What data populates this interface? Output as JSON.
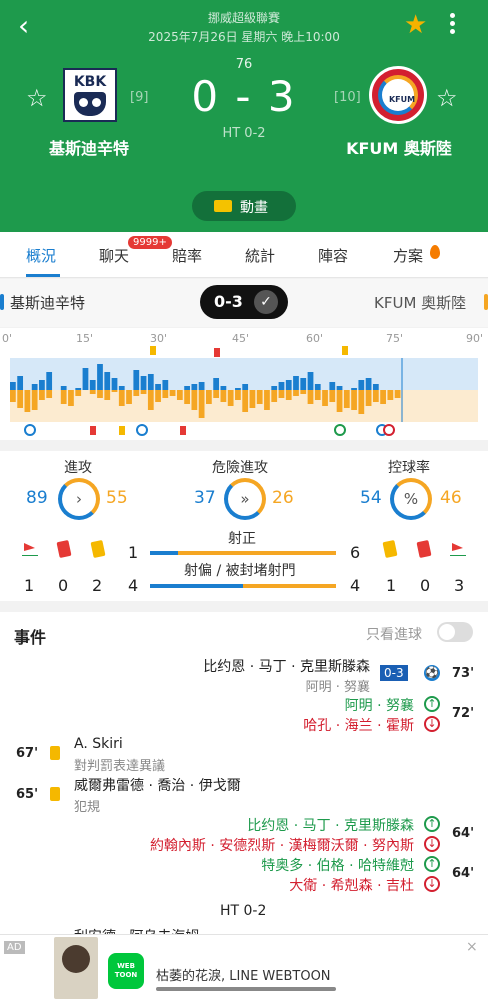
{
  "header": {
    "league": "挪威超級聯賽",
    "datetime": "2025年7月26日 星期六 晚上10:00",
    "minute": "76",
    "score": "0 - 3",
    "halftime": "HT 0-2",
    "home": {
      "name": "基斯迪辛特",
      "rank": "[9]",
      "logo_text": "KBK"
    },
    "away": {
      "name": "KFUM 奧斯陸",
      "rank": "[10]",
      "logo_text": "KFUM"
    },
    "animation_label": "動畫",
    "back_icon": "back-arrow-icon",
    "favorite_icon": "star-icon"
  },
  "tabs": [
    {
      "label": "概況",
      "active": true
    },
    {
      "label": "聊天",
      "badge": "9999+"
    },
    {
      "label": "賠率"
    },
    {
      "label": "統計"
    },
    {
      "label": "陣容"
    },
    {
      "label": "方案"
    }
  ],
  "teambar": {
    "home": "基斯迪辛特",
    "away": "KFUM 奧斯陸",
    "score": "0-3"
  },
  "timeline": {
    "ticks": [
      "0'",
      "15'",
      "30'",
      "45'",
      "60'",
      "75'",
      "90'"
    ],
    "home_color": "#1a7ecf",
    "away_color": "#f5a623"
  },
  "stats": {
    "attack": {
      "label": "進攻",
      "home": "89",
      "away": "55"
    },
    "dangerous": {
      "label": "危險進攻",
      "home": "37",
      "away": "26"
    },
    "possession": {
      "label": "控球率",
      "home": "54",
      "away": "46",
      "glyph": "%"
    },
    "on_target": {
      "label": "射正",
      "home": "1",
      "away": "6"
    },
    "off_target": {
      "label": "射偏 / 被封堵射門",
      "home": "4",
      "away": "4"
    },
    "home_corners": "1",
    "home_reds": "0",
    "home_yellows": "2",
    "away_yellows": "1",
    "away_reds": "0",
    "away_corners": "3"
  },
  "events": {
    "title": "事件",
    "goals_only": "只看進球",
    "items": {
      "goal_73_player": "比约恩 · 马丁 · 克里斯滕森",
      "goal_73_score": "0-3",
      "goal_73_assist": "阿明 · 努襄",
      "goal_73_min": "73'",
      "sub_72_in": "阿明 · 努襄",
      "sub_72_out": "哈孔 · 海兰 · 霍斯",
      "sub_72_min": "72'",
      "card_67_player": "A. Skiri",
      "card_67_reason": "對判罰表達異議",
      "card_67_min": "67'",
      "card_65_player": "威爾弗雷德 · 喬治 · 伊戈爾",
      "card_65_reason": "犯規",
      "card_65_min": "65'",
      "sub_64a_in": "比约恩 · 马丁 · 克里斯滕森",
      "sub_64a_out": "約翰內斯 · 安德烈斯 · 漢梅爾沃爾 · 努內斯",
      "sub_64a_min": "64'",
      "sub_64b_in": "特奥多 · 伯格 · 哈特維尅",
      "sub_64b_out": "大衛 · 希剋森 · 吉杜",
      "sub_64b_min": "64'",
      "ht": "HT 0-2",
      "cut": "利安德 · 阿乌夫海姆"
    }
  },
  "ad": {
    "tag": "AD",
    "logo": "WEB TOON",
    "text": "枯萎的花淚, LINE WEBTOON",
    "close": "×"
  }
}
